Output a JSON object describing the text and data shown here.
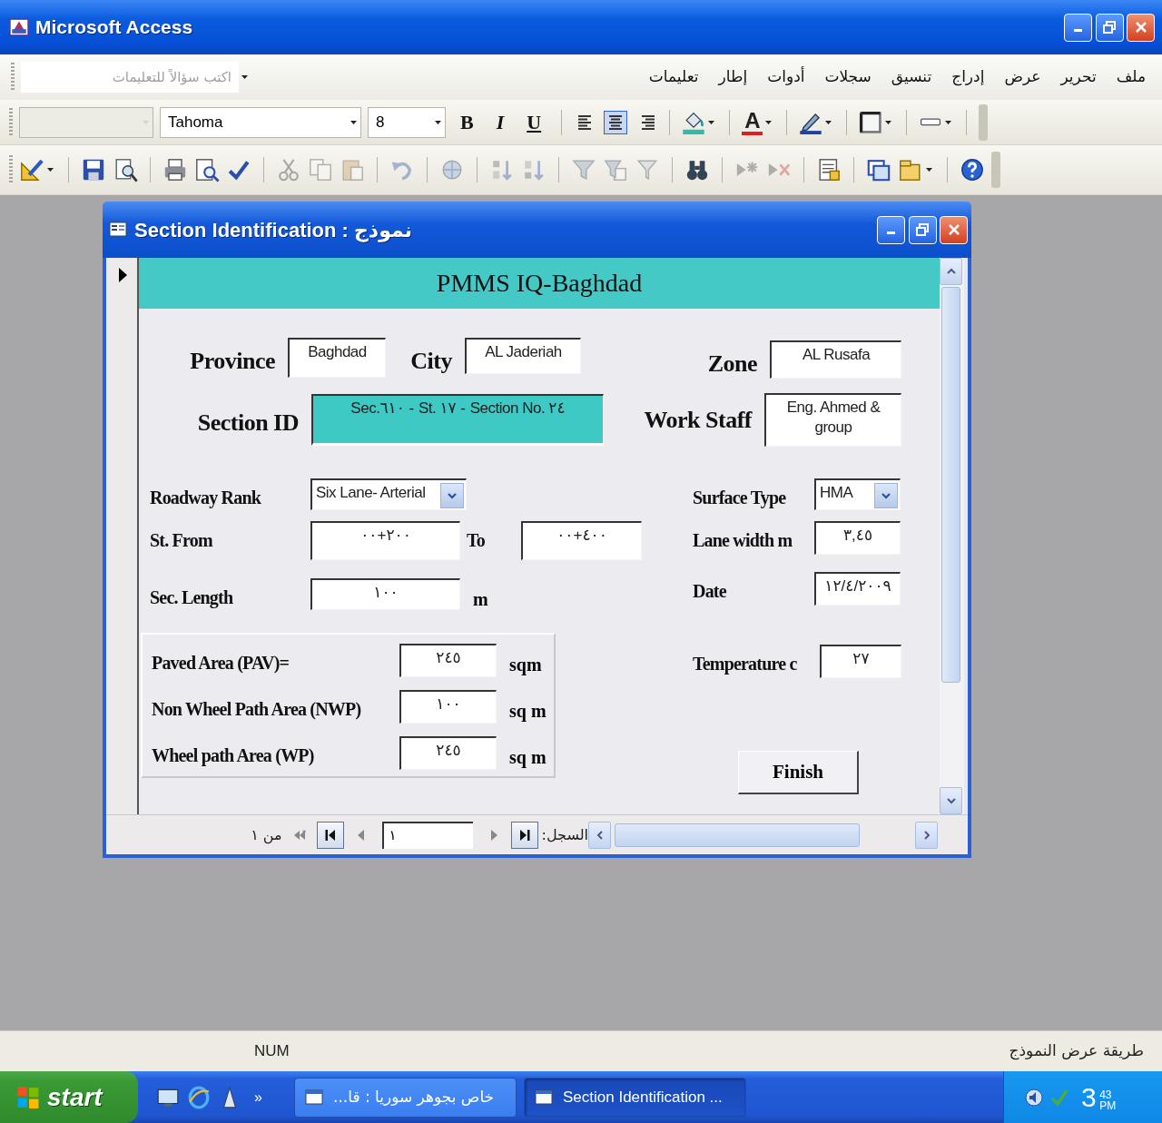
{
  "window": {
    "title": "Microsoft Access"
  },
  "menu_bar": {
    "items": [
      "ملف",
      "تحرير",
      "عرض",
      "إدراج",
      "تنسيق",
      "سجلات",
      "أدوات",
      "إطار",
      "تعليمات"
    ],
    "help_box": {
      "placeholder": "اكتب سؤالاً للتعليمات"
    }
  },
  "formatting_toolbar": {
    "object_box": {
      "disabled": true
    },
    "font": "Tahoma",
    "font_size": "8",
    "bold": "B",
    "italic": "I",
    "underline": "U",
    "alignments": [
      {
        "kind": "left",
        "selected": false
      },
      {
        "kind": "center",
        "selected": true
      },
      {
        "kind": "right",
        "selected": false
      }
    ],
    "tools": [
      {
        "kind": "fill-color"
      },
      {
        "kind": "font-color",
        "label": "A"
      },
      {
        "kind": "line-color"
      },
      {
        "kind": "border"
      },
      {
        "kind": "line-style"
      }
    ]
  },
  "standard_toolbar": {
    "groups": [
      [
        {
          "kind": "design-view",
          "disabled": false
        }
      ],
      [
        {
          "kind": "save",
          "disabled": false
        },
        {
          "kind": "file-search",
          "disabled": false
        }
      ],
      [
        {
          "kind": "print",
          "disabled": false
        },
        {
          "kind": "preview",
          "disabled": false
        },
        {
          "kind": "spelling",
          "disabled": false
        }
      ],
      [
        {
          "kind": "cut",
          "disabled": true
        },
        {
          "kind": "copy",
          "disabled": true
        },
        {
          "kind": "paste",
          "disabled": true
        }
      ],
      [
        {
          "kind": "undo",
          "disabled": true
        }
      ],
      [
        {
          "kind": "hyperlink",
          "disabled": true
        }
      ],
      [
        {
          "kind": "sort-asc",
          "disabled": true
        },
        {
          "kind": "sort-desc",
          "disabled": true
        }
      ],
      [
        {
          "kind": "filter-selection",
          "disabled": true
        },
        {
          "kind": "filter-form",
          "disabled": true
        },
        {
          "kind": "apply-filter",
          "disabled": true
        }
      ],
      [
        {
          "kind": "find",
          "disabled": false
        }
      ],
      [
        {
          "kind": "new-record",
          "disabled": true
        },
        {
          "kind": "delete-record",
          "disabled": true
        }
      ],
      [
        {
          "kind": "properties",
          "disabled": false
        }
      ],
      [
        {
          "kind": "database-window",
          "disabled": false
        },
        {
          "kind": "new-object",
          "disabled": false
        }
      ],
      [
        {
          "kind": "help",
          "disabled": false
        }
      ]
    ]
  },
  "form": {
    "title": "Section Identification : نموذج",
    "header": "PMMS IQ-Baghdad",
    "province": {
      "label": "Province",
      "value": "Baghdad"
    },
    "city": {
      "label": "City",
      "value": "AL Jaderiah"
    },
    "section_id": {
      "label": "Section ID",
      "value": "Sec.٦١٠ - St. ١٧ - Section No. ٢٤"
    },
    "top_right": [
      {
        "label": "Zone",
        "value": "AL Rusafa",
        "kind": "text"
      },
      {
        "label": "Work Staff",
        "value": "Eng. Ahmed & group",
        "kind": "text"
      }
    ],
    "roadway_rank": {
      "label": "Roadway Rank",
      "value": "Six Lane- Arterial"
    },
    "st_from": {
      "label": "St. From",
      "value": "٠٠+٢٠٠"
    },
    "to": {
      "label": "To",
      "value": "٠٠+٤٠٠"
    },
    "sec_length": {
      "label": "Sec. Length",
      "value": "١٠٠",
      "unit": "m"
    },
    "detail_right": [
      {
        "label": "Surface Type",
        "value": "HMA",
        "kind": "combo"
      },
      {
        "label": "Lane width m",
        "value": "٣,٤٥",
        "kind": "text"
      },
      {
        "label": "Date",
        "value": "١٢/٤/٢٠٠٩",
        "kind": "text"
      }
    ],
    "areas": [
      {
        "label": "Paved Area (PAV)=",
        "value": "٢٤٥",
        "unit": "sqm"
      },
      {
        "label": "Non Wheel Path Area (NWP)",
        "value": "١٠٠",
        "unit": "sq m"
      },
      {
        "label": "Wheel path Area (WP)",
        "value": "٢٤٥",
        "unit": "sq m"
      }
    ],
    "temperature": {
      "label": "Temperature c",
      "value": "٢٧"
    },
    "finish_button": "Finish",
    "navigation": {
      "label": "السجل:",
      "buttons_right": [
        {
          "kind": "last",
          "disabled": false
        },
        {
          "kind": "next",
          "disabled": true
        }
      ],
      "record": "١",
      "buttons_left": [
        {
          "kind": "previous",
          "disabled": true
        },
        {
          "kind": "first",
          "disabled": false
        },
        {
          "kind": "new",
          "disabled": true
        }
      ],
      "total": "من ١"
    }
  },
  "status_bar": {
    "view": "طريقة عرض النموذج",
    "num": "NUM"
  },
  "taskbar": {
    "start": "start",
    "quick_launch_more": "»",
    "document_task": {
      "label": "خاص بجوهر سوريا : قا...",
      "selected": false
    },
    "form_task": {
      "label": "Section Identification ...",
      "selected": true
    },
    "clock": {
      "hour": "3",
      "minutes": "43",
      "period": "PM"
    }
  }
}
